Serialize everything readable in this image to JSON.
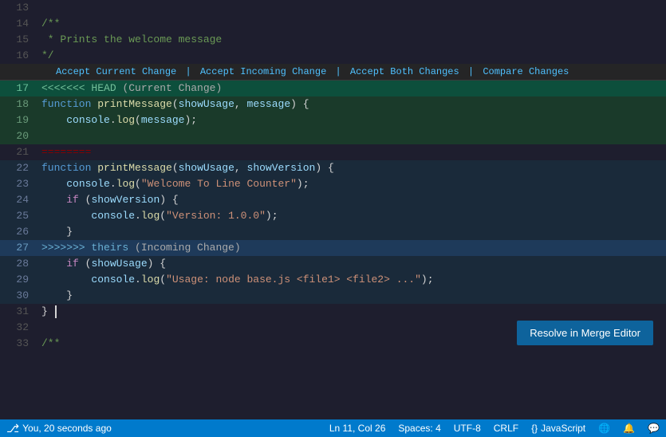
{
  "editor": {
    "lines": [
      {
        "num": 13,
        "type": "normal",
        "tokens": [
          {
            "text": "",
            "class": ""
          }
        ]
      },
      {
        "num": 14,
        "type": "normal",
        "raw": "/**"
      },
      {
        "num": 15,
        "type": "normal",
        "raw": " * Prints the welcome message"
      },
      {
        "num": 16,
        "type": "normal",
        "raw": "*/"
      }
    ],
    "conflict_bar": {
      "actions": [
        "Accept Current Change",
        "Accept Incoming Change",
        "Accept Both Changes",
        "Compare Changes"
      ]
    }
  },
  "status_bar": {
    "source_control": "You, 20 seconds ago",
    "position": "Ln 11, Col 26",
    "spaces": "Spaces: 4",
    "encoding": "UTF-8",
    "eol": "CRLF",
    "language": "JavaScript"
  },
  "resolve_button": {
    "label": "Resolve in Merge Editor"
  }
}
